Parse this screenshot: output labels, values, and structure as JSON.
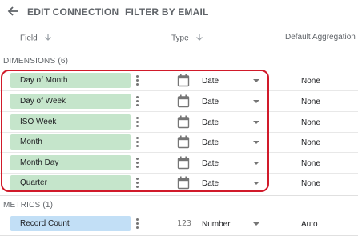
{
  "header": {
    "edit_connection": "EDIT CONNECTION",
    "separator": "|",
    "filter_by_email": "FILTER BY EMAIL"
  },
  "columns": {
    "field": "Field",
    "type": "Type",
    "default_aggregation": "Default Aggregation"
  },
  "dimensions": {
    "heading": "DIMENSIONS (6)",
    "rows": [
      {
        "name": "Day of Month",
        "type": "Date",
        "aggregation": "None"
      },
      {
        "name": "Day of Week",
        "type": "Date",
        "aggregation": "None"
      },
      {
        "name": "ISO Week",
        "type": "Date",
        "aggregation": "None"
      },
      {
        "name": "Month",
        "type": "Date",
        "aggregation": "None"
      },
      {
        "name": "Month Day",
        "type": "Date",
        "aggregation": "None"
      },
      {
        "name": "Quarter",
        "type": "Date",
        "aggregation": "None"
      }
    ]
  },
  "metrics": {
    "heading": "METRICS (1)",
    "rows": [
      {
        "name": "Record Count",
        "type_icon": "123",
        "type": "Number",
        "aggregation": "Auto"
      }
    ]
  },
  "colors": {
    "dimension_chip": "#c5e5cb",
    "metric_chip": "#c2dff6",
    "highlight": "#d11a2a"
  },
  "icons": {
    "back": "arrow-left-icon",
    "sort": "arrow-down-icon",
    "date_type": "calendar-icon",
    "menu": "kebab-menu-icon",
    "dropdown": "caret-down-icon"
  }
}
